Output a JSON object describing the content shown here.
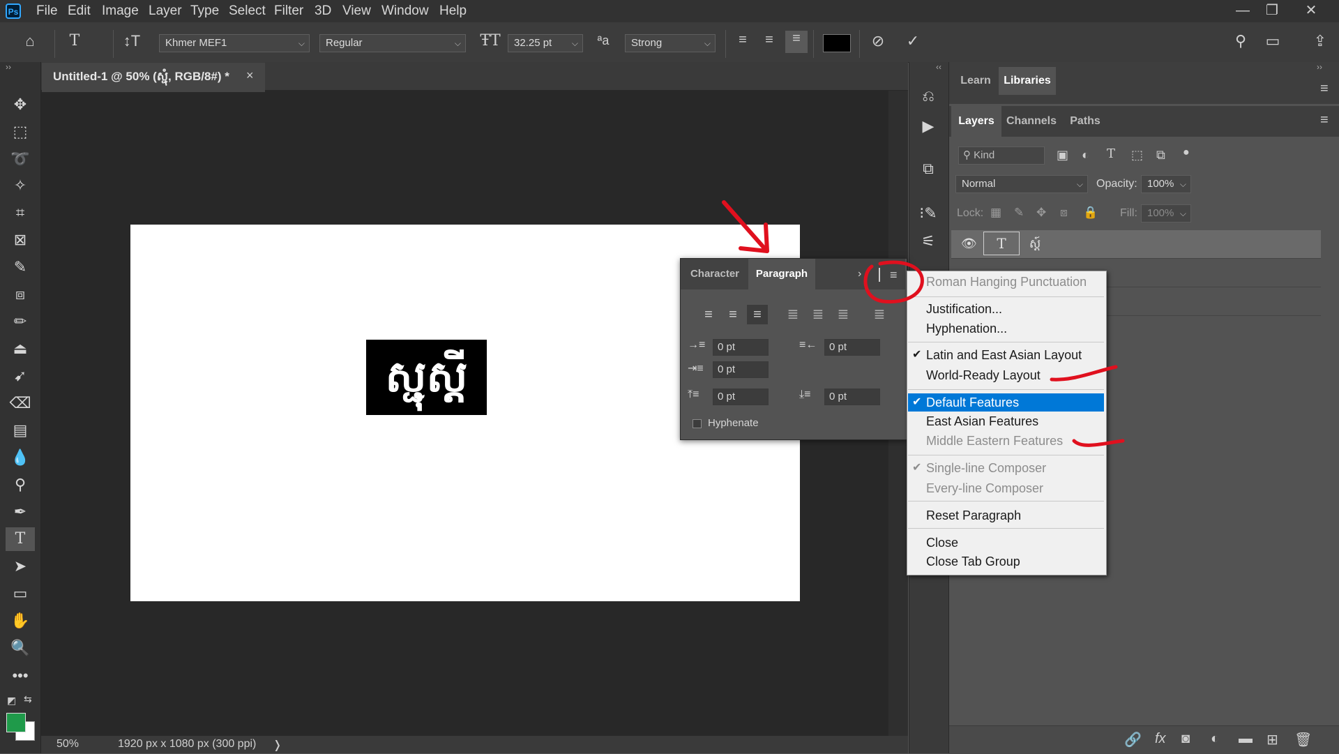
{
  "menubar": {
    "logo": "Ps",
    "items": [
      "File",
      "Edit",
      "Image",
      "Layer",
      "Type",
      "Select",
      "Filter",
      "3D",
      "View",
      "Window",
      "Help"
    ],
    "window_controls": [
      "—",
      "❐",
      "✕"
    ]
  },
  "options": {
    "font_family": "Khmer MEF1",
    "font_style": "Regular",
    "font_size": "32.25 pt",
    "aa_label": "ªa",
    "anti_alias": "Strong",
    "text_color": "#000000"
  },
  "document": {
    "tab_title": "Untitled-1 @ 50% (ស្ជុំ, RGB/8#) *",
    "close_glyph": "×",
    "canvas_text": "ស្ជុស្តី",
    "zoom": "50%",
    "doc_size": "1920 px x 1080 px (300 ppi)",
    "status_arrow": "❭"
  },
  "paragraph_panel": {
    "tabs": [
      "Character",
      "Paragraph"
    ],
    "indent_left": "0 pt",
    "indent_right": "0 pt",
    "indent_first": "0 pt",
    "space_before": "0 pt",
    "space_after": "0 pt",
    "hyphenate_label": "Hyphenate"
  },
  "flyout_menu": {
    "items": [
      {
        "label": "Roman Hanging Punctuation",
        "enabled": false,
        "checked": false
      },
      {
        "label": "Justification...",
        "enabled": true,
        "checked": false
      },
      {
        "label": "Hyphenation...",
        "enabled": true,
        "checked": false
      },
      {
        "label": "Latin and East Asian Layout",
        "enabled": true,
        "checked": true
      },
      {
        "label": "World-Ready Layout",
        "enabled": true,
        "checked": false
      },
      {
        "label": "Default Features",
        "enabled": true,
        "checked": true,
        "highlighted": true
      },
      {
        "label": "East Asian Features",
        "enabled": true,
        "checked": false
      },
      {
        "label": "Middle Eastern Features",
        "enabled": false,
        "checked": false
      },
      {
        "label": "Single-line Composer",
        "enabled": false,
        "checked": true
      },
      {
        "label": "Every-line Composer",
        "enabled": false,
        "checked": false
      },
      {
        "label": "Reset Paragraph",
        "enabled": true,
        "checked": false
      },
      {
        "label": "Close",
        "enabled": true,
        "checked": false
      },
      {
        "label": "Close Tab Group",
        "enabled": true,
        "checked": false
      }
    ],
    "check_glyph": "✔"
  },
  "right_panel": {
    "top_tabs": [
      "Learn",
      "Libraries"
    ],
    "layer_tabs": [
      "Layers",
      "Channels",
      "Paths"
    ],
    "filter_kind": "Kind",
    "blend_mode": "Normal",
    "opacity_label": "Opacity:",
    "opacity_value": "100%",
    "lock_label": "Lock:",
    "fill_label": "Fill:",
    "fill_value": "100%",
    "layer_name": "ស្ត៍"
  },
  "colors": {
    "foreground": "#1f9a4a",
    "background": "#ffffff",
    "accent": "#0078d7",
    "annotation": "#e0101e"
  }
}
